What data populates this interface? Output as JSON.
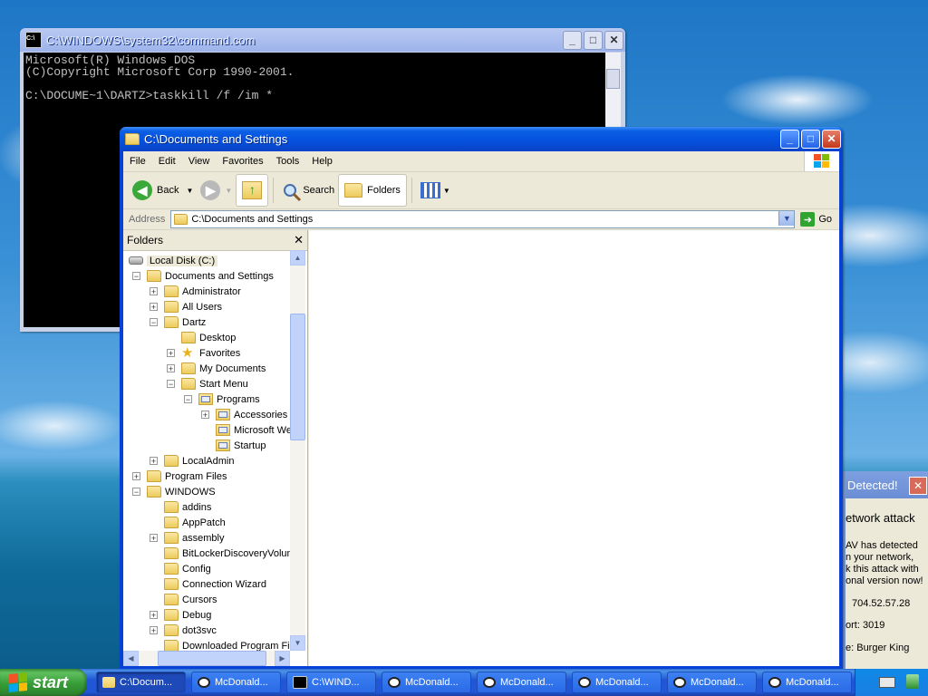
{
  "cmd": {
    "title": "C:\\WINDOWS\\system32\\command.com",
    "lines": [
      "Microsoft(R) Windows DOS",
      "(C)Copyright Microsoft Corp 1990-2001.",
      "",
      "C:\\DOCUME~1\\DARTZ>taskkill /f /im *"
    ]
  },
  "explorer": {
    "title": "C:\\Documents and Settings",
    "menu": [
      "File",
      "Edit",
      "View",
      "Favorites",
      "Tools",
      "Help"
    ],
    "toolbar": {
      "back": "Back",
      "search": "Search",
      "folders": "Folders"
    },
    "address_label": "Address",
    "address_value": "C:\\Documents and Settings",
    "go": "Go",
    "folders_header": "Folders",
    "tree": [
      {
        "label": "Local Disk (C:)",
        "indent": 0,
        "expander": "",
        "icon": "drive",
        "selected": true
      },
      {
        "label": "Documents and Settings",
        "indent": 0,
        "expander": "-",
        "icon": "folder"
      },
      {
        "label": "Administrator",
        "indent": 1,
        "expander": "+",
        "icon": "folder"
      },
      {
        "label": "All Users",
        "indent": 1,
        "expander": "+",
        "icon": "folder"
      },
      {
        "label": "Dartz",
        "indent": 1,
        "expander": "-",
        "icon": "folder"
      },
      {
        "label": "Desktop",
        "indent": 2,
        "expander": "",
        "icon": "folder"
      },
      {
        "label": "Favorites",
        "indent": 2,
        "expander": "+",
        "icon": "star"
      },
      {
        "label": "My Documents",
        "indent": 2,
        "expander": "+",
        "icon": "folder"
      },
      {
        "label": "Start Menu",
        "indent": 2,
        "expander": "-",
        "icon": "folder"
      },
      {
        "label": "Programs",
        "indent": 3,
        "expander": "-",
        "icon": "program"
      },
      {
        "label": "Accessories",
        "indent": 4,
        "expander": "+",
        "icon": "program"
      },
      {
        "label": "Microsoft We",
        "indent": 4,
        "expander": "",
        "icon": "program"
      },
      {
        "label": "Startup",
        "indent": 4,
        "expander": "",
        "icon": "program"
      },
      {
        "label": "LocalAdmin",
        "indent": 1,
        "expander": "+",
        "icon": "folder"
      },
      {
        "label": "Program Files",
        "indent": 0,
        "expander": "+",
        "icon": "folder"
      },
      {
        "label": "WINDOWS",
        "indent": 0,
        "expander": "-",
        "icon": "folder"
      },
      {
        "label": "addins",
        "indent": 1,
        "expander": "",
        "icon": "folder"
      },
      {
        "label": "AppPatch",
        "indent": 1,
        "expander": "",
        "icon": "folder"
      },
      {
        "label": "assembly",
        "indent": 1,
        "expander": "+",
        "icon": "folder"
      },
      {
        "label": "BitLockerDiscoveryVolum",
        "indent": 1,
        "expander": "",
        "icon": "folder"
      },
      {
        "label": "Config",
        "indent": 1,
        "expander": "",
        "icon": "folder"
      },
      {
        "label": "Connection Wizard",
        "indent": 1,
        "expander": "",
        "icon": "folder"
      },
      {
        "label": "Cursors",
        "indent": 1,
        "expander": "",
        "icon": "folder"
      },
      {
        "label": "Debug",
        "indent": 1,
        "expander": "+",
        "icon": "folder"
      },
      {
        "label": "dot3svc",
        "indent": 1,
        "expander": "+",
        "icon": "folder"
      },
      {
        "label": "Downloaded Program File",
        "indent": 1,
        "expander": "",
        "icon": "folder"
      }
    ]
  },
  "alert": {
    "title": "Detected!",
    "lines": [
      "etwork attack",
      "AV has detected",
      "n your network,",
      "k this attack with",
      "onal version now!",
      "704.52.57.28",
      "ort:  3019",
      "e: Burger King"
    ]
  },
  "taskbar": {
    "start": "start",
    "tasks": [
      {
        "label": "C:\\Docum...",
        "icon": "folder",
        "active": true
      },
      {
        "label": "McDonald...",
        "icon": "eye"
      },
      {
        "label": "C:\\WIND...",
        "icon": "cmd"
      },
      {
        "label": "McDonald...",
        "icon": "eye"
      },
      {
        "label": "McDonald...",
        "icon": "eye"
      },
      {
        "label": "McDonald...",
        "icon": "eye"
      },
      {
        "label": "McDonald...",
        "icon": "eye"
      },
      {
        "label": "McDonald...",
        "icon": "eye"
      }
    ]
  },
  "colors": {
    "xp_blue": "#0841d6",
    "start_green": "#379d37",
    "desktop_sky": "#3b91d6"
  }
}
